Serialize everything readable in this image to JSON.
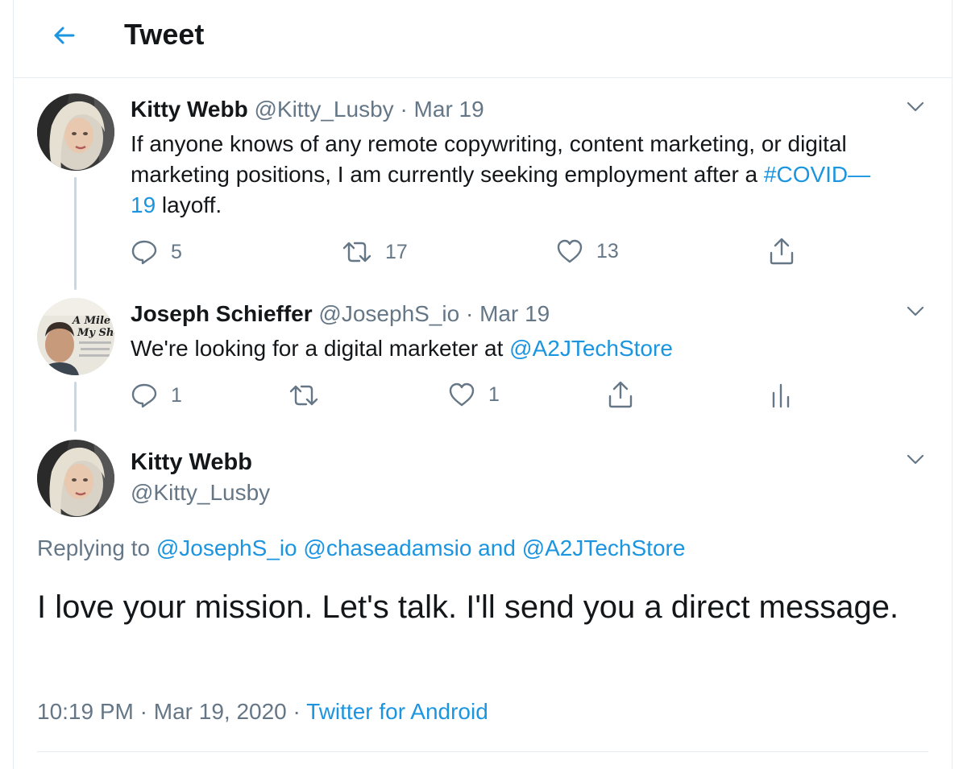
{
  "header": {
    "title": "Tweet",
    "back_icon": "arrow-left-icon"
  },
  "colors": {
    "accent": "#1b95e0",
    "muted": "#657786",
    "text": "#14171a",
    "divider": "#e6ecf0"
  },
  "tweet1": {
    "name": "Kitty Webb",
    "handle": "@Kitty_Lusby",
    "sep": "·",
    "date": "Mar 19",
    "text_pre": "If anyone knows of any remote copywriting, content marketing, or digital marketing positions, I am currently seeking employment after a ",
    "hashtag_a": "#COVID—",
    "hashtag_b": "19",
    "text_post": " layoff.",
    "replies": "5",
    "retweets": "17",
    "likes": "13"
  },
  "tweet2": {
    "name": "Joseph Schieffer",
    "handle": "@JosephS_io",
    "sep": "·",
    "date": "Mar 19",
    "text_pre": "We're looking for a digital marketer at ",
    "mention": "@A2JTechStore",
    "replies": "1",
    "likes": "1",
    "avatar_sign_line1": "A Mile i",
    "avatar_sign_line2": "My Shoe"
  },
  "main": {
    "name": "Kitty Webb",
    "handle": "@Kitty_Lusby",
    "replying_label": "Replying to ",
    "mention1": "@JosephS_io",
    "mention2": "@chaseadamsio",
    "and_label": " and ",
    "mention3": "@A2JTechStore",
    "text": "I love your mission. Let's talk. I'll send you a direct message.",
    "time": "10:19 PM",
    "sep": "·",
    "date": "Mar 19, 2020",
    "source": "Twitter for Android"
  }
}
